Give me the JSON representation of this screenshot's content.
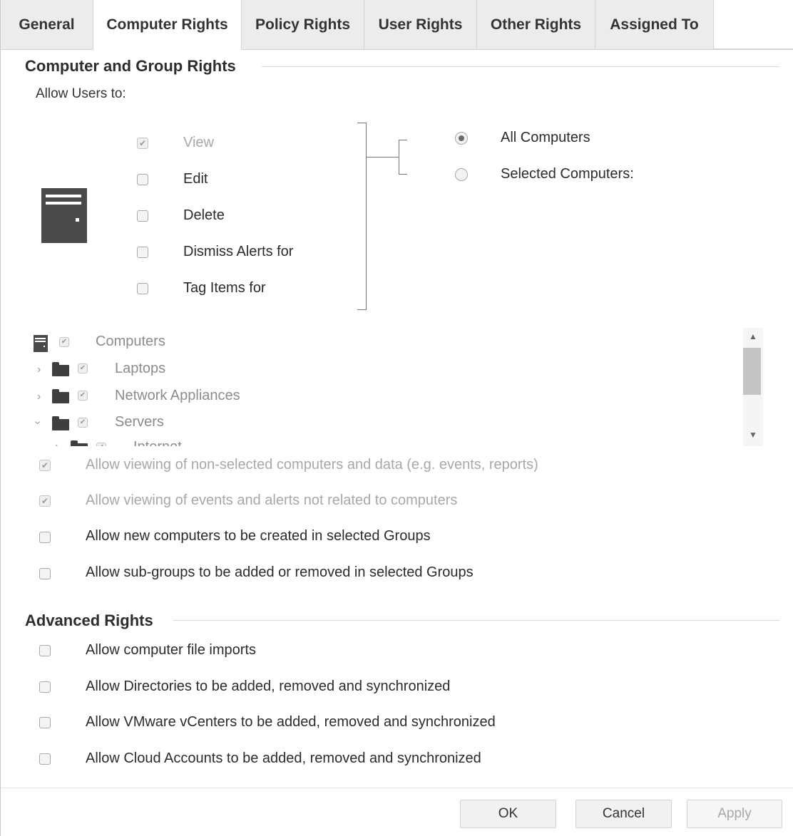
{
  "tabs": [
    {
      "label": "General"
    },
    {
      "label": "Computer Rights"
    },
    {
      "label": "Policy Rights"
    },
    {
      "label": "User Rights"
    },
    {
      "label": "Other Rights"
    },
    {
      "label": "Assigned To"
    }
  ],
  "active_tab": "Computer Rights",
  "computer_group_rights": {
    "title": "Computer and Group Rights",
    "allow_users_label": "Allow Users to:",
    "actions": [
      {
        "label": "View",
        "checked": true,
        "disabled": true
      },
      {
        "label": "Edit",
        "checked": false,
        "disabled": false
      },
      {
        "label": "Delete",
        "checked": false,
        "disabled": false
      },
      {
        "label": "Dismiss Alerts for",
        "checked": false,
        "disabled": false
      },
      {
        "label": "Tag Items for",
        "checked": false,
        "disabled": false
      }
    ],
    "scope": [
      {
        "label": "All Computers",
        "selected": true
      },
      {
        "label": "Selected Computers:",
        "selected": false
      }
    ],
    "tree": [
      {
        "label": "Computers",
        "icon": "computer-icon",
        "checked": true
      },
      {
        "label": "Laptops",
        "icon": "folder-icon",
        "expander": "chevron-right-icon",
        "checked": true
      },
      {
        "label": "Network Appliances",
        "icon": "folder-icon",
        "expander": "chevron-right-icon",
        "checked": true
      },
      {
        "label": "Servers",
        "icon": "folder-icon",
        "expander": "chevron-down-icon",
        "checked": true
      },
      {
        "label": "Internet",
        "icon": "folder-icon",
        "expander": "chevron-right-icon",
        "checked": true
      }
    ],
    "options": [
      {
        "label": "Allow viewing of non-selected computers and data (e.g. events, reports)",
        "checked": true,
        "disabled": true
      },
      {
        "label": "Allow viewing of events and alerts not related to computers",
        "checked": true,
        "disabled": true
      },
      {
        "label": "Allow new computers to be created in selected Groups",
        "checked": false,
        "disabled": false
      },
      {
        "label": "Allow sub-groups to be added or removed in selected Groups",
        "checked": false,
        "disabled": false
      }
    ]
  },
  "advanced_rights": {
    "title": "Advanced Rights",
    "options": [
      {
        "label": "Allow computer file imports",
        "checked": false
      },
      {
        "label": "Allow Directories to be added, removed and synchronized",
        "checked": false
      },
      {
        "label": "Allow VMware vCenters to be added, removed and synchronized",
        "checked": false
      },
      {
        "label": "Allow Cloud Accounts to be added, removed and synchronized",
        "checked": false
      }
    ]
  },
  "footer": {
    "ok_label": "OK",
    "cancel_label": "Cancel",
    "apply_label": "Apply",
    "apply_disabled": true
  },
  "colors": {
    "tab_inactive_bg": "#ececec",
    "tab_active_bg": "#ffffff",
    "disabled_text": "#a8a8a8"
  }
}
